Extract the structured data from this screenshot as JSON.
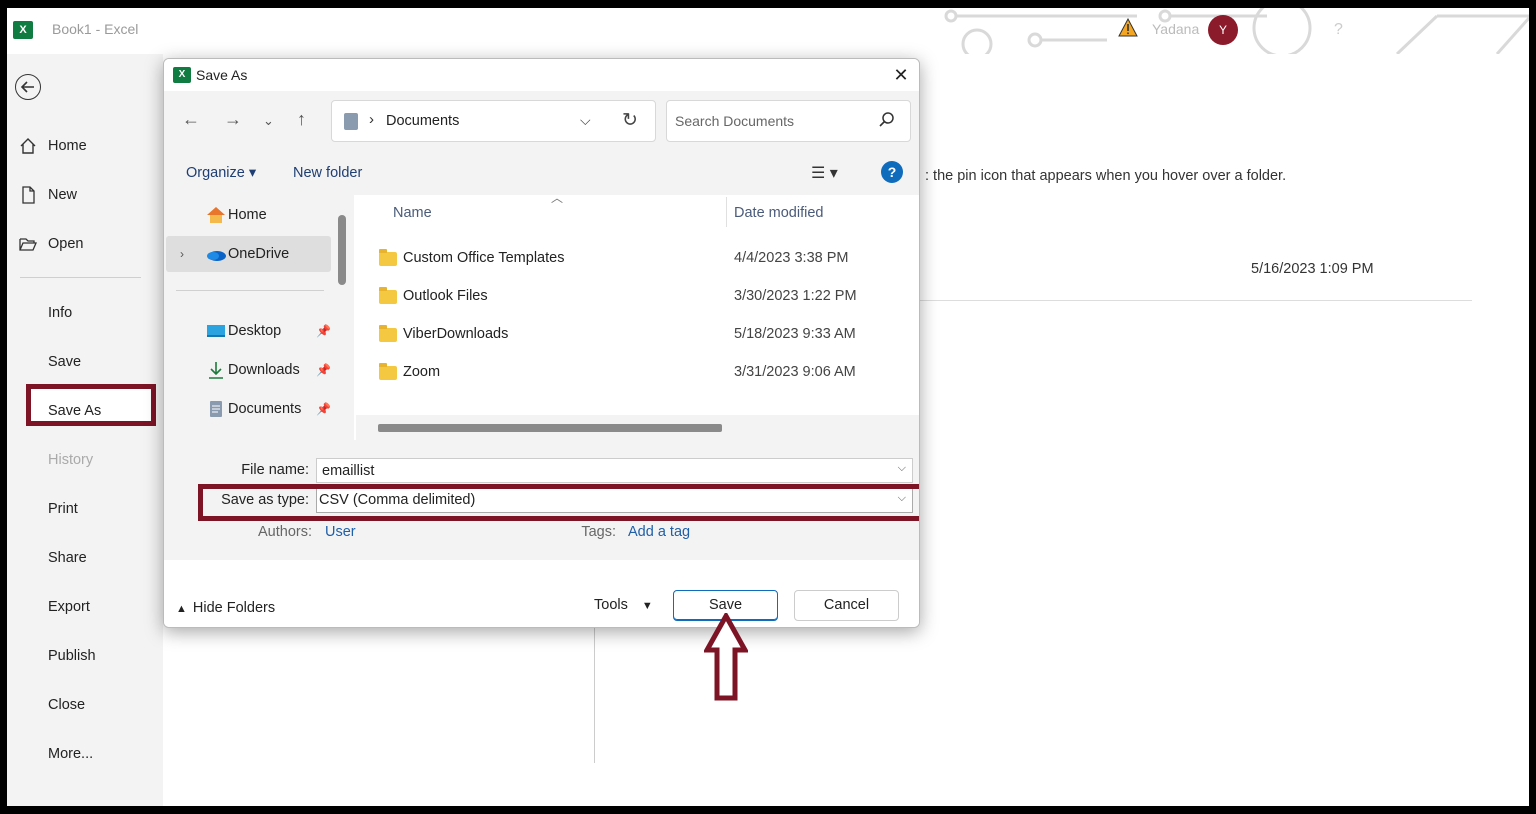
{
  "app": {
    "title": "Book1  -  Excel",
    "user": "Yadana",
    "avatar_initial": "Y",
    "help_glyph": "?"
  },
  "backstage": {
    "items": [
      {
        "label": "Home"
      },
      {
        "label": "New"
      },
      {
        "label": "Open"
      },
      {
        "label": "Info"
      },
      {
        "label": "Save"
      },
      {
        "label": "Save As"
      },
      {
        "label": "History"
      },
      {
        "label": "Print"
      },
      {
        "label": "Share"
      },
      {
        "label": "Export"
      },
      {
        "label": "Publish"
      },
      {
        "label": "Close"
      },
      {
        "label": "More..."
      }
    ]
  },
  "background": {
    "hint_text": ": the pin icon that appears when you hover over a folder.",
    "date": "5/16/2023 1:09 PM"
  },
  "dialog": {
    "title": "Save As",
    "close_glyph": "✕",
    "address": "Documents",
    "search_placeholder": "Search Documents",
    "organize": "Organize ▾",
    "new_folder": "New folder",
    "view_glyph": "☰ ▾",
    "help_glyph": "?",
    "nav": {
      "home": "Home",
      "onedrive": "OneDrive",
      "desktop": "Desktop",
      "downloads": "Downloads",
      "documents": "Documents"
    },
    "columns": {
      "name": "Name",
      "date": "Date modified"
    },
    "files": [
      {
        "name": "Custom Office Templates",
        "date": "4/4/2023 3:38 PM"
      },
      {
        "name": "Outlook Files",
        "date": "3/30/2023 1:22 PM"
      },
      {
        "name": "ViberDownloads",
        "date": "5/18/2023 9:33 AM"
      },
      {
        "name": "Zoom",
        "date": "3/31/2023 9:06 AM"
      }
    ],
    "file_name_label": "File name:",
    "file_name_value": "emaillist",
    "save_type_label": "Save as type:",
    "save_type_value": "CSV (Comma delimited)",
    "authors_label": "Authors:",
    "authors_value": "User",
    "tags_label": "Tags:",
    "tags_value": "Add a tag",
    "hide_folders": "Hide Folders",
    "tools": "Tools",
    "save_button": "Save",
    "cancel_button": "Cancel"
  },
  "colors": {
    "highlight": "#7c1426",
    "excel_green": "#107c41",
    "accent_blue": "#0f6cbd"
  }
}
